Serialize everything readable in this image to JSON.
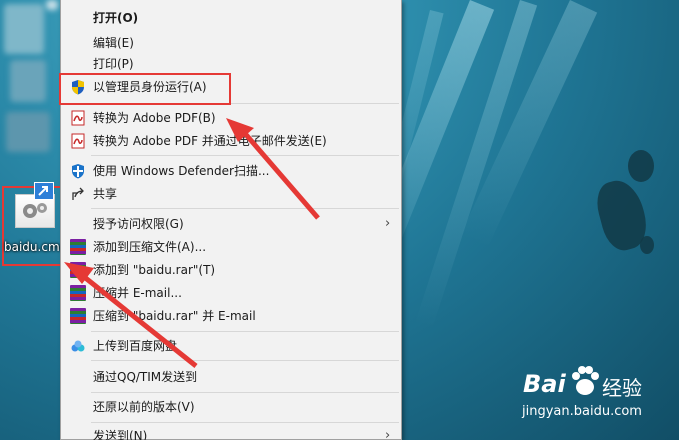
{
  "desktop": {
    "file_label": "baidu.cmd"
  },
  "menu": {
    "items": [
      {
        "label": "打开(O)"
      },
      {
        "label": "编辑(E)"
      },
      {
        "label": "打印(P)"
      },
      {
        "label": "以管理员身份运行(A)",
        "icon": "uac-shield-icon"
      },
      {
        "label": "转换为 Adobe PDF(B)",
        "icon": "adobe-pdf-icon"
      },
      {
        "label": "转换为 Adobe PDF 并通过电子邮件发送(E)",
        "icon": "adobe-pdf-email-icon"
      },
      {
        "label": "使用 Windows Defender扫描...",
        "icon": "windows-defender-icon"
      },
      {
        "label": "共享",
        "icon": "share-icon"
      },
      {
        "label": "授予访问权限(G)",
        "has_submenu": true
      },
      {
        "label": "添加到压缩文件(A)...",
        "icon": "winrar-icon"
      },
      {
        "label": "添加到 \"baidu.rar\"(T)",
        "icon": "winrar-icon"
      },
      {
        "label": "压缩并 E-mail...",
        "icon": "winrar-icon"
      },
      {
        "label": "压缩到 \"baidu.rar\" 并 E-mail",
        "icon": "winrar-icon"
      },
      {
        "label": "上传到百度网盘",
        "icon": "baidu-netdisk-icon"
      },
      {
        "label": "通过QQ/TIM发送到"
      },
      {
        "label": "还原以前的版本(V)"
      },
      {
        "label": "发送到(N)",
        "has_submenu": true
      }
    ]
  },
  "watermark": {
    "brand_a": "Bai",
    "brand_b": "经验",
    "url": "jingyan.baidu.com"
  },
  "colors": {
    "annotation_red": "#e53935",
    "menu_bg": "#f2f2f2",
    "desktop_water": "#1f7594"
  }
}
